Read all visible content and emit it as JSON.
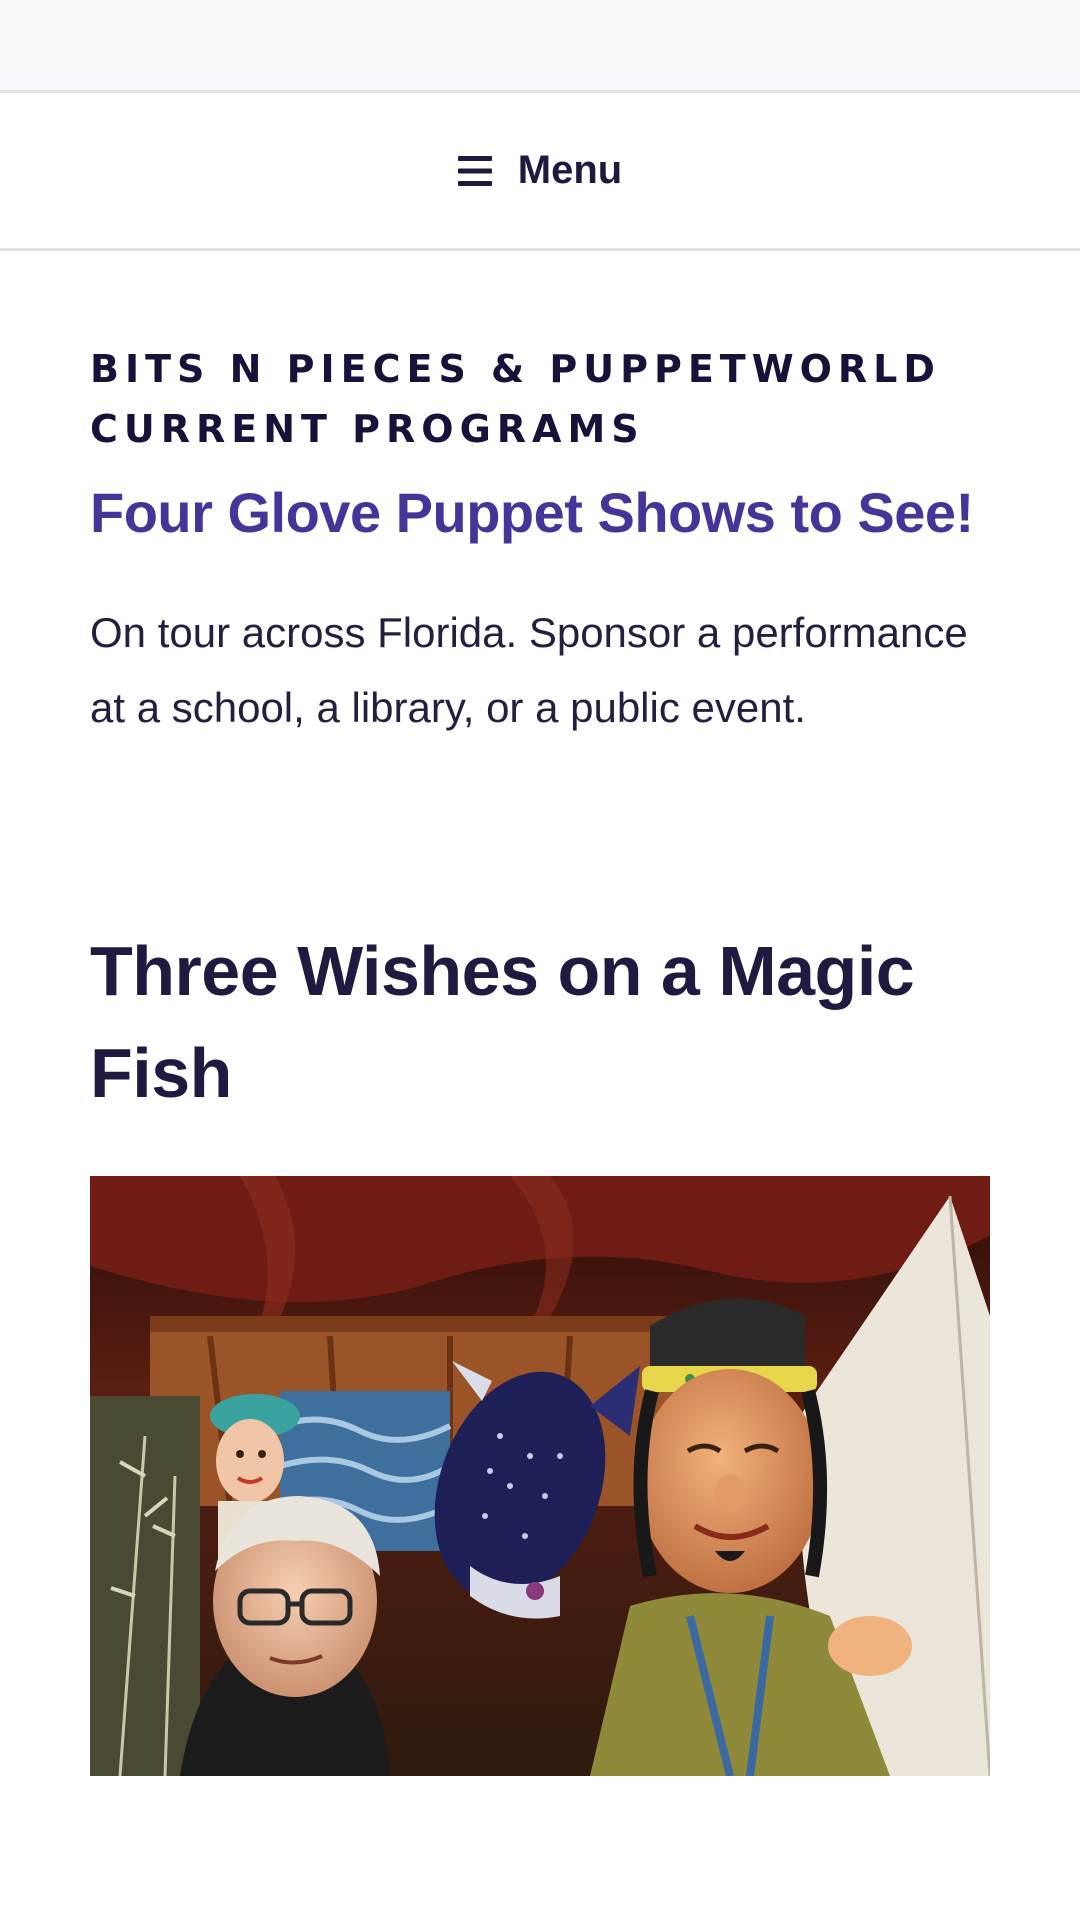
{
  "nav": {
    "menu_label": "Menu",
    "menu_icon": "hamburger-icon"
  },
  "page": {
    "heading_line1": "BITS N PIECES & PUPPETWORLD",
    "heading_line2": "CURRENT PROGRAMS",
    "post_link": "Four Glove Puppet Shows to See!",
    "intro": "On tour across Florida. Sponsor a performance at a school, a library, or a public event.",
    "section_title": "Three Wishes on a Magic Fish"
  },
  "colors": {
    "link": "#463499",
    "heading": "#16123a",
    "text": "#231f3f",
    "topbar": "#f9f8fd"
  }
}
